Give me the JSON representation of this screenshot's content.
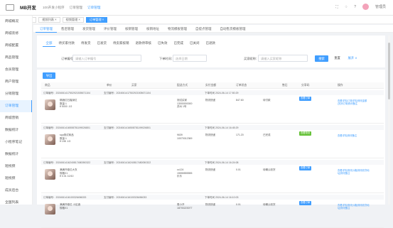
{
  "topbar": {
    "brand": "MB开发",
    "nav": [
      "100开发小程序",
      "订单管理",
      "订单管理"
    ],
    "user": "管理员"
  },
  "tags": [
    {
      "label": "首页",
      "active": false
    },
    {
      "label": "线上收款",
      "active": false
    },
    {
      "label": "视频列表 ×",
      "active": false
    },
    {
      "label": "视频管理 ×",
      "active": false
    },
    {
      "label": "订单管理 ×",
      "active": true
    }
  ],
  "sidebar": [
    "商城概况",
    "商城装修",
    "商城配置",
    "商品管理",
    "会员管理",
    "商户管理",
    "分销管理",
    "订单管理",
    "商城营销",
    "数据统计",
    "小程序笔记",
    "数据统计",
    "短视频",
    "短视频",
    "成员后台",
    "全国列表"
  ],
  "subtabs": [
    "订单管理",
    "售后管理",
    "发货管理",
    "评价管理",
    "核销管理",
    "核销地址",
    "物流模板管理",
    "自提点管理",
    "自动售货模板管理"
  ],
  "status_tabs": [
    "全部",
    "待买家付款",
    "待发货",
    "已发货",
    "待卖家核销",
    "退款待审核",
    "已失效",
    "已完成",
    "已关闭",
    "已退款"
  ],
  "filters": {
    "order_label": "订单编号：",
    "order_placeholder": "请输入订单编号",
    "time_label": "下单时间：",
    "time_placeholder": "选择日期",
    "buyer_label": "买家昵称：",
    "buyer_placeholder": "请输入买家昵称",
    "search_btn": "搜索",
    "reset_btn": "重置",
    "expand": "展开 ∨"
  },
  "export_btn": "导出",
  "columns": [
    "商品",
    "单价",
    "买家",
    "配送方式",
    "实付金额",
    "订单状态",
    "售后",
    "分享码",
    "操作"
  ],
  "orders": [
    {
      "order_no": "订单编号：2024061417502921505671104",
      "pay_no": "支付编号：2024061417502921505671104",
      "time": "下单时间 2024-06-14 17:50:29",
      "goods_name": "期酒红石榴深红",
      "goods_spec": "数量:1",
      "goods_price": "¥ 5000 .1G",
      "buyer_name": "测试买家",
      "buyer_phone": "13000000000",
      "buyer_addr": "苏州 1号",
      "delivery": "物流快递",
      "amount": "847.60",
      "status": "待付款",
      "btn": "查看订单",
      "btn_style": "primary",
      "ops": [
        "查看详情|订单详情|修改金额",
        "|关闭订单|修改备注"
      ]
    },
    {
      "order_no": "订单编号：2024061416508781199026801",
      "pay_no": "支付编号：2024061416508781199026801",
      "time": "下单时间 2024-06-14 16:45:29",
      "goods_name": "spp测试商品",
      "goods_spec": "数量:1",
      "goods_price": "¥ 198 .1G",
      "buyer_name": "9639",
      "buyer_phone": "10070012369",
      "buyer_addr": "",
      "delivery": "物流快递",
      "amount": "171.20",
      "status": "已完成",
      "btn": "查看物流",
      "btn_style": "ok",
      "ops": [
        "查看详情|修改备注"
      ]
    },
    {
      "order_no": "订单编号：2024061416240817480050322",
      "pay_no": "支付编号：2024061416240817480050322",
      "time": "下单时间 2024-06-14 16:24:08",
      "goods_name": "满满开卷红大衣",
      "goods_spec": "规格X1",
      "goods_price": "¥ 0.01  10/10",
      "buyer_name": "cc124",
      "buyer_phone": "15555555555",
      "buyer_addr": "乐乐",
      "delivery": "物流快递",
      "amount": "0.01",
      "status": "待确认收货",
      "btn": "查看订单",
      "btn_style": "primary",
      "ops": [
        "查看详情|修改价格|修改收货地",
        "址|修改备注"
      ]
    },
    {
      "order_no": "订单编号：2024061416100326456033",
      "pay_no": "支付编号：2024061416100326456033",
      "time": "下单时间 2024-06-14 16:10:03",
      "goods_name": "满满开卷红 小区酒",
      "goods_spec": "规格X1",
      "goods_price": "",
      "buyer_name": "周小开",
      "buyer_phone": "18700223077",
      "buyer_addr": "",
      "delivery": "物流快递",
      "amount": "0.01",
      "status": "待确认收货",
      "btn": "查看订单",
      "btn_style": "primary",
      "ops": [
        "查看详情|修改价格|修改收货地",
        "址|修改备注"
      ]
    }
  ]
}
